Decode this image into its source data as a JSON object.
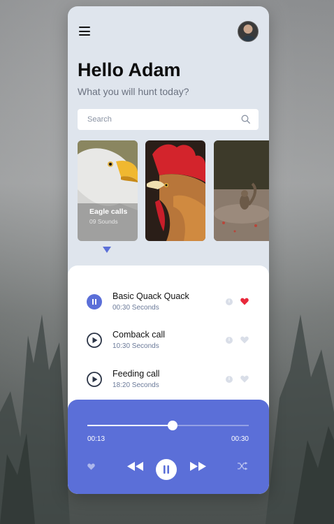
{
  "header": {
    "greeting": "Hello Adam",
    "subtitle": "What you will hunt today?"
  },
  "search": {
    "placeholder": "Search"
  },
  "categories": [
    {
      "title": "Eagle calls",
      "count": "09 Sounds"
    },
    {
      "title": "",
      "count": ""
    },
    {
      "title": "",
      "count": ""
    }
  ],
  "tracks": [
    {
      "name": "Basic Quack Quack",
      "duration": "00:30 Seconds",
      "playing": true,
      "liked": true
    },
    {
      "name": "Comback call",
      "duration": "10:30 Seconds",
      "playing": false,
      "liked": false
    },
    {
      "name": "Feeding call",
      "duration": "18:20 Seconds",
      "playing": false,
      "liked": false
    }
  ],
  "player": {
    "elapsed": "00:13",
    "total": "00:30",
    "progress": 0.53
  },
  "colors": {
    "accent": "#5b6fd8",
    "like": "#e8283b",
    "heart_inactive": "#d9dee8",
    "phone_bg": "#dfe5ed"
  },
  "icons": {
    "menu": "hamburger-icon",
    "search": "search-icon",
    "play": "play-icon",
    "pause": "pause-icon",
    "info": "info-icon",
    "heart": "heart-icon",
    "rewind": "rewind-icon",
    "fast_forward": "fast-forward-icon",
    "shuffle": "shuffle-icon"
  }
}
